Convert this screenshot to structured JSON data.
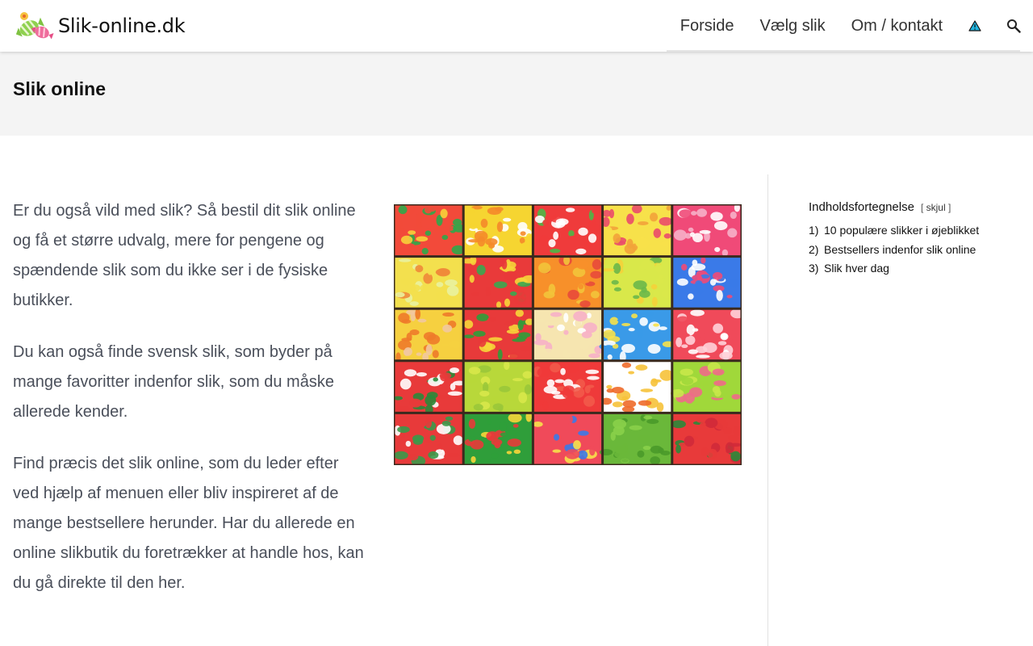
{
  "header": {
    "logo_text": "Slik-online.dk",
    "nav": [
      {
        "label": "Forside"
      },
      {
        "label": "Vælg slik"
      },
      {
        "label": "Om / kontakt"
      }
    ],
    "icons": [
      "warning-triangle-icon",
      "search-icon"
    ]
  },
  "page": {
    "title": "Slik online"
  },
  "content": {
    "paragraphs": [
      "Er du også vild med slik? Så bestil dit slik online og få et større udvalg, mere for pengene og spændende slik som du ikke ser i de fysiske butikker.",
      "Du kan også finde svensk slik, som byder på mange favoritter indenfor slik, som du måske allerede kender.",
      "Find præcis det slik online, som du leder efter ved hjælp af menuen eller bliv inspireret af de mange bestsellere herunder. Har du allerede en online slikbutik du foretrækker at handle hos, kan du gå direkte til den her."
    ]
  },
  "toc": {
    "title": "Indholdsfortegnelse",
    "toggle_open": "[",
    "toggle_label": "skjul",
    "toggle_close": "]",
    "items": [
      {
        "num": "1)",
        "label": "10 populære slikker i øjeblikket"
      },
      {
        "num": "2)",
        "label": "Bestsellers indenfor slik online"
      },
      {
        "num": "3)",
        "label": "Slik hver dag"
      }
    ]
  },
  "colors": {
    "body_text": "#4a4f5a",
    "title_band": "#f4f4f4",
    "nav_text": "#333333",
    "warning_icon_fill": "#22b5e0"
  }
}
